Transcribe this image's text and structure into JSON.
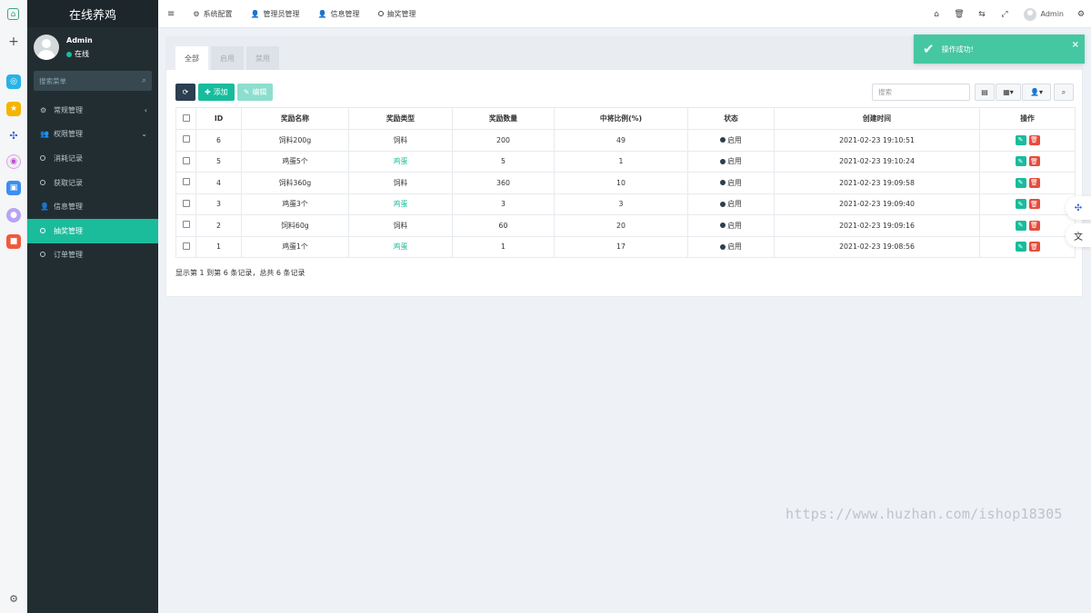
{
  "sidebar": {
    "app_title": "在线养鸡",
    "user_name": "Admin",
    "user_status": "在线",
    "search_placeholder": "搜索菜单",
    "items": [
      {
        "label": "常规管理",
        "icon": "cogs-icon",
        "arrow": "‹"
      },
      {
        "label": "权限管理",
        "icon": "group-icon",
        "arrow": "⌄"
      },
      {
        "label": "消耗记录",
        "icon": "circle-icon"
      },
      {
        "label": "获取记录",
        "icon": "circle-icon"
      },
      {
        "label": "信息管理",
        "icon": "user-icon"
      },
      {
        "label": "抽奖管理",
        "icon": "circle-icon",
        "active": true
      },
      {
        "label": "订单管理",
        "icon": "circle-icon"
      }
    ]
  },
  "topbar": {
    "nav": [
      {
        "label": "系统配置",
        "icon": "gear-icon"
      },
      {
        "label": "管理员管理",
        "icon": "user-icon"
      },
      {
        "label": "信息管理",
        "icon": "user-icon"
      },
      {
        "label": "抽奖管理",
        "icon": "circle-icon"
      }
    ],
    "user_name": "Admin"
  },
  "tabs": [
    "全部",
    "启用",
    "禁用"
  ],
  "toolbar": {
    "add_label": "添加",
    "edit_label": "编辑",
    "search_placeholder": "搜索"
  },
  "table": {
    "columns": [
      "ID",
      "奖励名称",
      "奖励类型",
      "奖励数量",
      "中将比例(%)",
      "状态",
      "创建时间",
      "操作"
    ],
    "rows": [
      {
        "id": "6",
        "name": "饲料200g",
        "type": "饲料",
        "qty": "200",
        "ratio": "49",
        "status": "启用",
        "created": "2021-02-23 19:10:51"
      },
      {
        "id": "5",
        "name": "鸡蛋5个",
        "type": "鸡蛋",
        "qty": "5",
        "ratio": "1",
        "status": "启用",
        "created": "2021-02-23 19:10:24"
      },
      {
        "id": "4",
        "name": "饲料360g",
        "type": "饲料",
        "qty": "360",
        "ratio": "10",
        "status": "启用",
        "created": "2021-02-23 19:09:58"
      },
      {
        "id": "3",
        "name": "鸡蛋3个",
        "type": "鸡蛋",
        "qty": "3",
        "ratio": "3",
        "status": "启用",
        "created": "2021-02-23 19:09:40"
      },
      {
        "id": "2",
        "name": "饲料60g",
        "type": "饲料",
        "qty": "60",
        "ratio": "20",
        "status": "启用",
        "created": "2021-02-23 19:09:16"
      },
      {
        "id": "1",
        "name": "鸡蛋1个",
        "type": "鸡蛋",
        "qty": "1",
        "ratio": "17",
        "status": "启用",
        "created": "2021-02-23 19:08:56"
      }
    ]
  },
  "pager_text": "显示第 1 到第 6 条记录，总共 6 条记录",
  "toast": {
    "message": "操作成功!"
  },
  "watermark": "https://www.huzhan.com/ishop18305",
  "colors": {
    "accent": "#18bc9c",
    "sidebar": "#222d32",
    "danger": "#e74c3c",
    "dark": "#2c3e50"
  }
}
